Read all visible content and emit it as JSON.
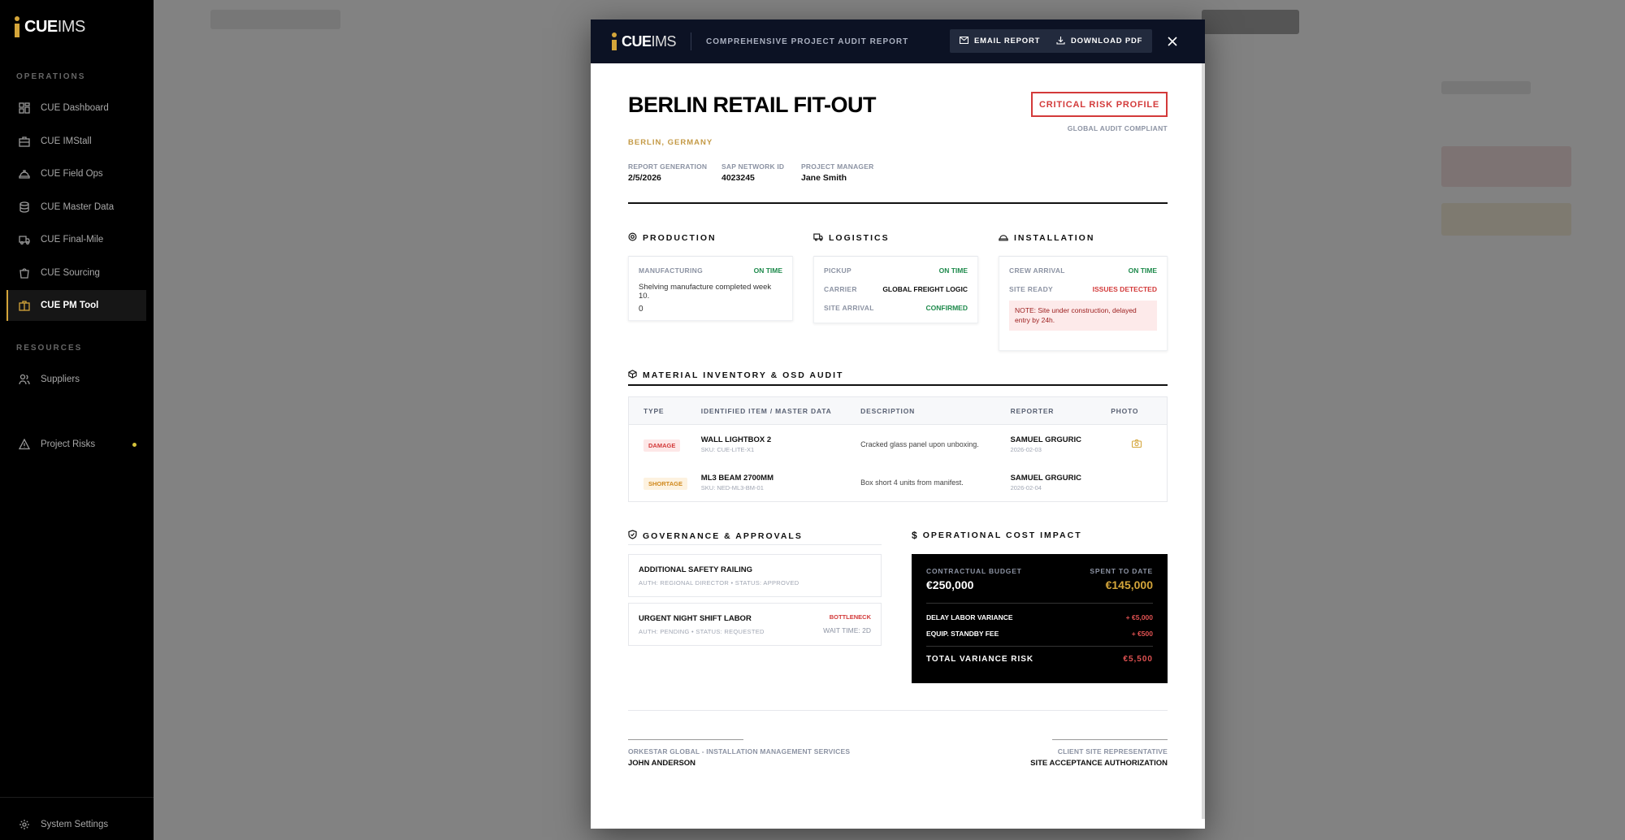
{
  "sidebar": {
    "brand": {
      "bold": "CUE",
      "light": "IMS"
    },
    "sections": {
      "operations": "OPERATIONS",
      "resources": "RESOURCES"
    },
    "items": [
      {
        "label": "CUE Dashboard",
        "icon": "dashboard-icon"
      },
      {
        "label": "CUE IMStall",
        "icon": "toolbox-icon"
      },
      {
        "label": "CUE Field Ops",
        "icon": "helmet-icon"
      },
      {
        "label": "CUE Master Data",
        "icon": "database-icon"
      },
      {
        "label": "CUE Final-Mile",
        "icon": "truck-icon"
      },
      {
        "label": "CUE Sourcing",
        "icon": "bag-icon"
      },
      {
        "label": "CUE PM Tool",
        "icon": "briefcase-icon",
        "active": true
      }
    ],
    "resources": [
      {
        "label": "Suppliers",
        "icon": "users-icon"
      },
      {
        "label": "Project Risks",
        "icon": "warning-icon"
      }
    ],
    "settings": "System Settings"
  },
  "modal": {
    "brand": {
      "bold": "CUE",
      "light": "IMS"
    },
    "title": "COMPREHENSIVE PROJECT AUDIT REPORT",
    "email_btn": "EMAIL REPORT",
    "download_btn": "DOWNLOAD PDF"
  },
  "report": {
    "project": "BERLIN RETAIL FIT-OUT",
    "location": "BERLIN, GERMANY",
    "risk_badge": "CRITICAL RISK PROFILE",
    "compliance": "GLOBAL AUDIT COMPLIANT",
    "meta": [
      {
        "key": "REPORT GENERATION",
        "value": "2/5/2026"
      },
      {
        "key": "SAP NETWORK ID",
        "value": "4023245"
      },
      {
        "key": "PROJECT MANAGER",
        "value": "Jane Smith"
      }
    ],
    "production": {
      "heading": "PRODUCTION",
      "label": "MANUFACTURING",
      "status": "ON TIME",
      "text": "Shelving manufacture completed week 10.",
      "value": "0"
    },
    "logistics": {
      "heading": "LOGISTICS",
      "rows": [
        {
          "key": "PICKUP",
          "value": "ON TIME"
        },
        {
          "key": "CARRIER",
          "value": "GLOBAL FREIGHT LOGIC"
        },
        {
          "key": "SITE ARRIVAL",
          "value": "CONFIRMED"
        }
      ]
    },
    "installation": {
      "heading": "INSTALLATION",
      "rows": [
        {
          "key": "CREW ARRIVAL",
          "value": "ON TIME"
        },
        {
          "key": "SITE READY",
          "value": "ISSUES DETECTED"
        }
      ],
      "note": "NOTE: Site under construction, delayed entry by 24h."
    },
    "inventory": {
      "heading": "MATERIAL INVENTORY & OSD AUDIT",
      "columns": [
        "TYPE",
        "IDENTIFIED ITEM / MASTER DATA",
        "DESCRIPTION",
        "REPORTER",
        "PHOTO"
      ],
      "rows": [
        {
          "type": "DAMAGE",
          "item": "WALL LIGHTBOX 2",
          "sku": "SKU: CUE-LITE-X1",
          "desc": "Cracked glass panel upon unboxing.",
          "reporter": "SAMUEL GRGURIC",
          "date": "2026-02-03",
          "photo": true
        },
        {
          "type": "SHORTAGE",
          "item": "ML3 BEAM 2700MM",
          "sku": "SKU: NED-ML3-BM-01",
          "desc": "Box short 4 units from manifest.",
          "reporter": "SAMUEL GRGURIC",
          "date": "2026-02-04",
          "photo": false
        }
      ]
    },
    "governance": {
      "heading": "GOVERNANCE & APPROVALS",
      "items": [
        {
          "title": "ADDITIONAL SAFETY RAILING",
          "sub": "AUTH: REGIONAL DIRECTOR • STATUS: APPROVED"
        },
        {
          "title": "URGENT NIGHT SHIFT LABOR",
          "sub": "AUTH: PENDING • STATUS: REQUESTED",
          "flag": "BOTTLENECK",
          "wait": "WAIT TIME: 2D"
        }
      ]
    },
    "cost": {
      "heading": "OPERATIONAL COST IMPACT",
      "budget_label": "CONTRACTUAL BUDGET",
      "budget": "€250,000",
      "spent_label": "SPENT TO DATE",
      "spent": "€145,000",
      "rows": [
        {
          "key": "DELAY LABOR VARIANCE",
          "value": "+ €5,000"
        },
        {
          "key": "EQUIP. STANDBY FEE",
          "value": "+ €500"
        }
      ],
      "total_label": "TOTAL VARIANCE RISK",
      "total": "€5,500"
    },
    "signatures": {
      "left_org": "ORKESTAR GLOBAL - INSTALLATION MANAGEMENT SERVICES",
      "left_name": "JOHN ANDERSON",
      "right_role": "CLIENT SITE REPRESENTATIVE",
      "right_name": "SITE ACCEPTANCE AUTHORIZATION"
    }
  },
  "colors": {
    "accent": "#d4a53a",
    "danger": "#d33a3a",
    "success": "#1e8a4c",
    "header": "#0c1224"
  }
}
